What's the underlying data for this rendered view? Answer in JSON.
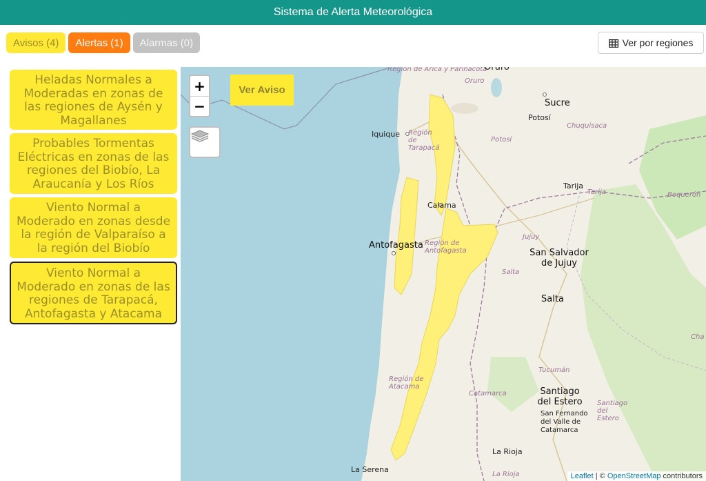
{
  "header": {
    "title": "Sistema de Alerta Meteorológica"
  },
  "filters": [
    {
      "label": "Avisos (4)",
      "color": "#ffe934"
    },
    {
      "label": "Alertas (1)",
      "color": "#ff7d10"
    },
    {
      "label": "Alarmas (0)",
      "color": "#c2c2c2"
    }
  ],
  "regions_button": {
    "label": "Ver por regiones",
    "icon": "table-grid-icon"
  },
  "warnings": [
    {
      "text": "Heladas Normales a Moderadas en zonas de las regiones de Aysén y Magallanes"
    },
    {
      "text": "Probables Tormentas Eléctricas en zonas de las regiones del Biobío, La Araucanía y Los Ríos"
    },
    {
      "text": "Viento Normal a Moderado en zonas desde la región de Valparaíso a la región del Biobío"
    },
    {
      "text": "Viento Normal a Moderado en zonas de las regiones de Tarapacá, Antofagasta y Atacama",
      "selected": true
    }
  ],
  "map": {
    "zoom_in": "+",
    "zoom_out": "−",
    "layers_icon": "layers-icon",
    "ver_aviso": "Ver Aviso",
    "attribution": {
      "leaflet": "Leaflet",
      "sep": " | © ",
      "osm": "OpenStreetMap",
      "tail": " contributors"
    },
    "labels": {
      "arica": "Región de Arica y Parinacota",
      "oruro_top": "Oruro",
      "oruro": "Oruro",
      "sucre": "Sucre",
      "potosi_city": "Potosí",
      "chuquisaca": "Chuquisaca",
      "iquique": "Iquique",
      "tarapaca": "Región de Tarapacá",
      "potosi_dep": "Potosí",
      "tarija_city": "Tarija",
      "tarija_dep": "Tarija",
      "boqueron": "Boquerón",
      "calama": "Calama",
      "antofagasta": "Antofagasta",
      "antofagasta_reg": "Región de Antofagasta",
      "jujuy": "Jujuy",
      "sansalvador": "San Salvador de Jujuy",
      "salta_prov": "Salta",
      "salta": "Salta",
      "chaco": "Cha",
      "tucuman": "Tucumán",
      "atacama": "Región de Atacama",
      "catamarca": "Catamarca",
      "santiago": "Santiago del Estero",
      "santiago_prov": "Santiago del Estero",
      "sanfernando": "San Fernando del Valle de Catamarca",
      "larioja": "La Rioja",
      "larioja_prov": "La Rioja",
      "laserena": "La Serena"
    }
  }
}
